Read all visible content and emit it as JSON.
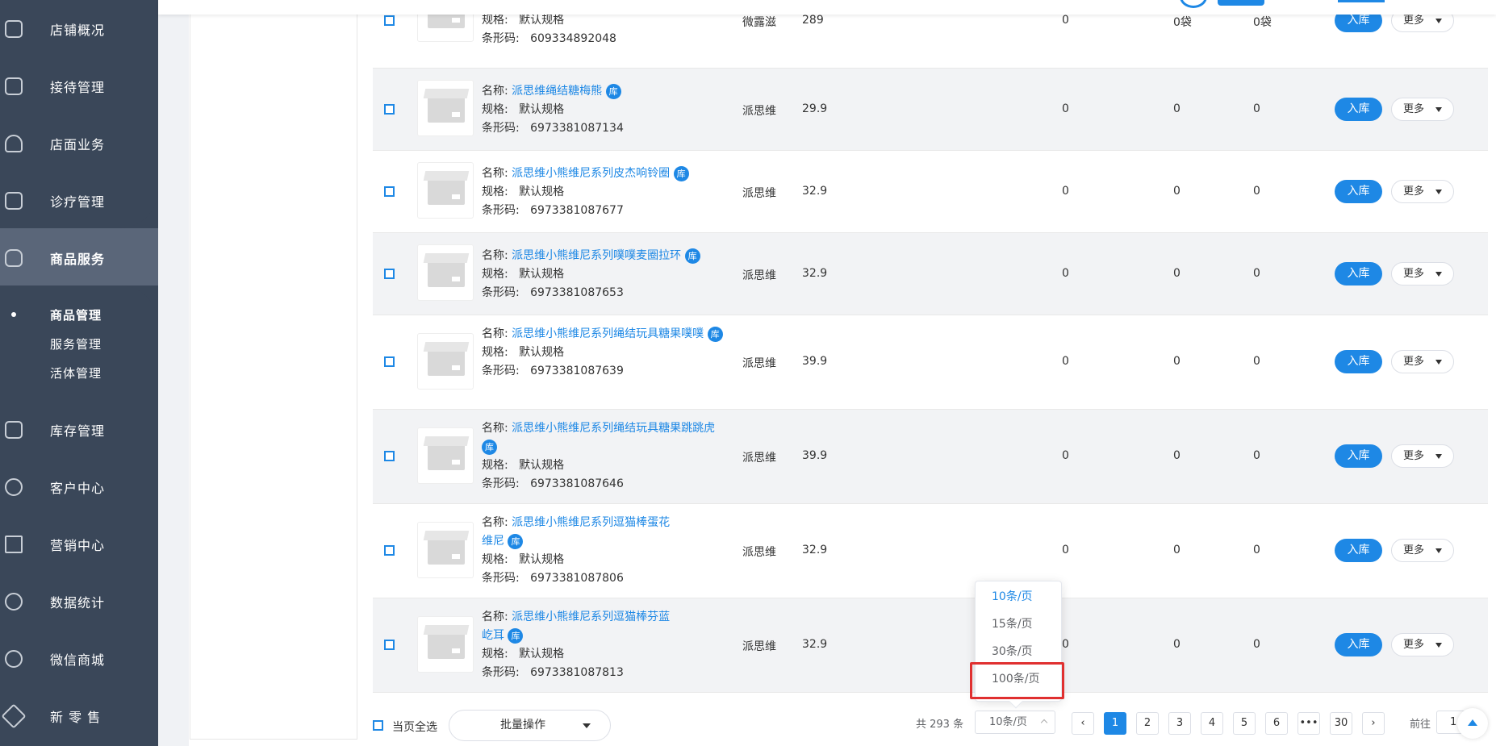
{
  "sidebar": {
    "items": [
      {
        "label": "店铺概况",
        "icon": "dashboard-icon"
      },
      {
        "label": "接待管理",
        "icon": "reception-icon"
      },
      {
        "label": "店面业务",
        "icon": "store-icon"
      },
      {
        "label": "诊疗管理",
        "icon": "medical-icon"
      },
      {
        "label": "商品服务",
        "icon": "goods-icon"
      },
      {
        "label": "库存管理",
        "icon": "inventory-icon"
      },
      {
        "label": "客户中心",
        "icon": "customer-icon"
      },
      {
        "label": "营销中心",
        "icon": "marketing-icon"
      },
      {
        "label": "数据统计",
        "icon": "stats-icon"
      },
      {
        "label": "微信商城",
        "icon": "wechat-mall-icon"
      },
      {
        "label": "新 零 售",
        "icon": "retail-icon"
      }
    ],
    "sub_items": [
      {
        "label": "商品管理"
      },
      {
        "label": "服务管理"
      },
      {
        "label": "活体管理"
      }
    ]
  },
  "labels": {
    "name": "名称: ",
    "spec": "规格:",
    "barcode": "条形码:",
    "tag": "库",
    "stock_in": "入库",
    "more": "更多"
  },
  "rows": [
    {
      "name": "",
      "spec": "默认规格",
      "barcode": "609334892048",
      "brand": "微露滋",
      "price": "289",
      "c1": "0",
      "c2": "0袋",
      "c3": "0袋"
    },
    {
      "name": "派思维绳结糖梅熊",
      "spec": "默认规格",
      "barcode": "6973381087134",
      "brand": "派思维",
      "price": "29.9",
      "c1": "0",
      "c2": "0",
      "c3": "0"
    },
    {
      "name": "派思维小熊维尼系列皮杰响铃圈",
      "spec": "默认规格",
      "barcode": "6973381087677",
      "brand": "派思维",
      "price": "32.9",
      "c1": "0",
      "c2": "0",
      "c3": "0"
    },
    {
      "name": "派思维小熊维尼系列噗噗麦圈拉环",
      "spec": "默认规格",
      "barcode": "6973381087653",
      "brand": "派思维",
      "price": "32.9",
      "c1": "0",
      "c2": "0",
      "c3": "0"
    },
    {
      "name": "派思维小熊维尼系列绳结玩具糖果噗噗",
      "spec": "默认规格",
      "barcode": "6973381087639",
      "brand": "派思维",
      "price": "39.9",
      "c1": "0",
      "c2": "0",
      "c3": "0"
    },
    {
      "name": "派思维小熊维尼系列绳结玩具糖果跳跳虎",
      "spec": "默认规格",
      "barcode": "6973381087646",
      "brand": "派思维",
      "price": "39.9",
      "c1": "0",
      "c2": "0",
      "c3": "0"
    },
    {
      "name": "派思维小熊维尼系列逗猫棒蛋花维尼",
      "spec": "默认规格",
      "barcode": "6973381087806",
      "brand": "派思维",
      "price": "32.9",
      "c1": "0",
      "c2": "0",
      "c3": "0"
    },
    {
      "name": "派思维小熊维尼系列逗猫棒芬蓝屹耳",
      "spec": "默认规格",
      "barcode": "6973381087813",
      "brand": "派思维",
      "price": "32.9",
      "c1": "0",
      "c2": "0",
      "c3": "0"
    }
  ],
  "footer": {
    "select_all": "当页全选",
    "bulk_action": "批量操作",
    "total": "共 293 条",
    "page_size": "10条/页",
    "pages": [
      "1",
      "2",
      "3",
      "4",
      "5",
      "6",
      "•••",
      "30"
    ],
    "goto_label": "前往",
    "goto_value": "1"
  },
  "page_size_options": [
    "10条/页",
    "15条/页",
    "30条/页",
    "100条/页"
  ],
  "colors": {
    "accent": "#1e88e5",
    "sidebar": "#3a4759",
    "highlight": "#e03030"
  }
}
